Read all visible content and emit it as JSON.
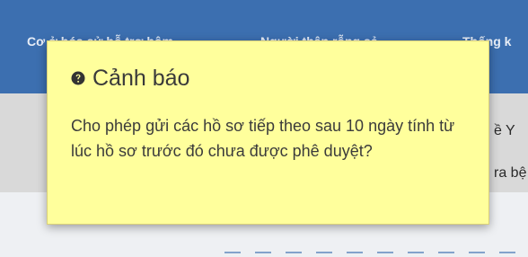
{
  "nav": {
    "items": [
      "Cơ ở hóa sử hỗ trợ hôm",
      "Người thân rỗng sẻ",
      "Thống k"
    ]
  },
  "background": {
    "right_text_1": "ề Y",
    "right_text_2": "ra bệ"
  },
  "alert": {
    "title": "Cảnh báo",
    "message": "Cho phép gửi các hồ sơ tiếp theo sau 10 ngày tính từ lúc hồ sơ trước đó chưa được phê duyệt?",
    "icon": "question-circle-icon"
  }
}
